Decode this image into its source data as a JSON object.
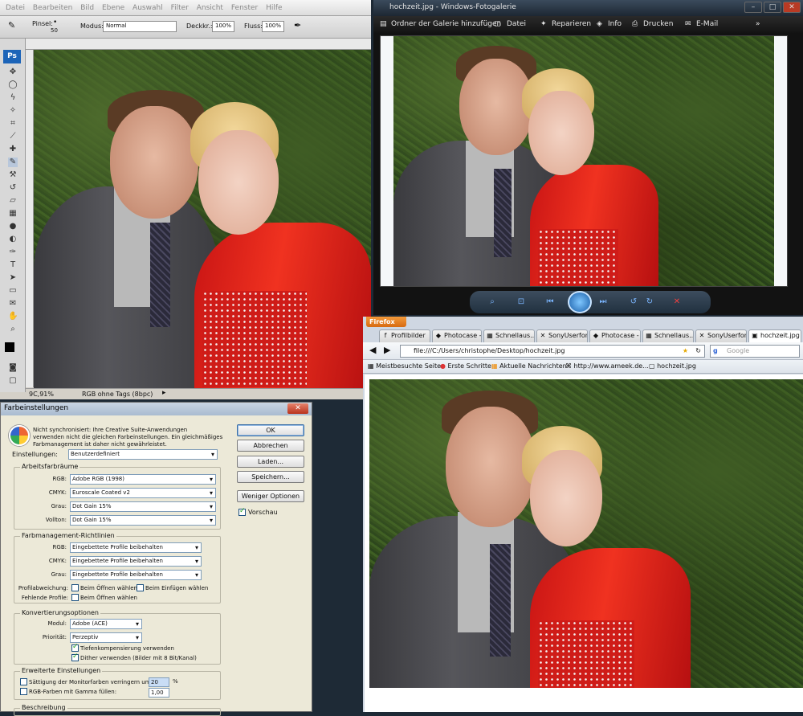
{
  "photoshop": {
    "menu": [
      "Datei",
      "Bearbeiten",
      "Bild",
      "Ebene",
      "Auswahl",
      "Filter",
      "Ansicht",
      "Fenster",
      "Hilfe"
    ],
    "options": {
      "brush_label": "Pinsel:",
      "brush_size": "50",
      "mode_label": "Modus:",
      "mode_value": "Normal",
      "opacity_label": "Deckkr.:",
      "opacity_value": "100%",
      "flow_label": "Fluss:",
      "flow_value": "100%"
    },
    "logo": "Ps",
    "status": {
      "zoom": "9C,91%",
      "profile": "RGB ohne Tags (8bpc)"
    }
  },
  "gallery": {
    "title": "hochzeit.jpg - Windows-Fotogalerie",
    "toolbar": [
      "Ordner der Galerie hinzufügen",
      "Datei",
      "Reparieren",
      "Info",
      "Drucken",
      "E-Mail"
    ],
    "overflow": "»",
    "controls": {
      "min": "–",
      "max": "□",
      "close": "✕"
    }
  },
  "firefox": {
    "app_button": "Firefox",
    "tabs": [
      {
        "icon": "f",
        "label": "Profilbilder"
      },
      {
        "icon": "◆",
        "label": "Photocase - ..."
      },
      {
        "icon": "▦",
        "label": "Schnellaus..."
      },
      {
        "icon": "✕",
        "label": "SonyUserfor..."
      },
      {
        "icon": "◆",
        "label": "Photocase - ..."
      },
      {
        "icon": "▦",
        "label": "Schnellaus..."
      },
      {
        "icon": "✕",
        "label": "SonyUserfor..."
      },
      {
        "icon": "▣",
        "label": "hochzeit.jpg"
      }
    ],
    "url": "file:///C:/Users/christophe/Desktop/hochzeit.jpg",
    "search_placeholder": "Google",
    "bookmarks": [
      "Meistbesuchte Seiten",
      "Erste Schritte",
      "Aktuelle Nachrichten",
      "http://www.ameek.de...",
      "hochzeit.jpg"
    ]
  },
  "dialog": {
    "title": "Farbeinstellungen",
    "close": "✕",
    "warning_lines": [
      "Nicht synchronisiert: Ihre Creative Suite-Anwendungen",
      "verwenden nicht die gleichen Farbeinstellungen. Ein gleichmäßiges",
      "Farbmanagement ist daher nicht gewährleistet."
    ],
    "buttons": [
      "OK",
      "Abbrechen",
      "Laden...",
      "Speichern...",
      "Weniger Optionen"
    ],
    "preview_label": "Vorschau",
    "settings_label": "Einstellungen:",
    "settings_value": "Benutzerdefiniert",
    "workspaces": {
      "title": "Arbeitsfarbräume",
      "rows": [
        {
          "label": "RGB:",
          "value": "Adobe RGB (1998)"
        },
        {
          "label": "CMYK:",
          "value": "Euroscale Coated v2"
        },
        {
          "label": "Grau:",
          "value": "Dot Gain 15%"
        },
        {
          "label": "Vollton:",
          "value": "Dot Gain 15%"
        }
      ]
    },
    "policies": {
      "title": "Farbmanagement-Richtlinien",
      "rows": [
        {
          "label": "RGB:",
          "value": "Eingebettete Profile beibehalten"
        },
        {
          "label": "CMYK:",
          "value": "Eingebettete Profile beibehalten"
        },
        {
          "label": "Grau:",
          "value": "Eingebettete Profile beibehalten"
        }
      ],
      "mismatch_label": "Profilabweichung:",
      "mismatch_open": "Beim Öffnen wählen",
      "mismatch_paste": "Beim Einfügen wählen",
      "missing_label": "Fehlende Profile:",
      "missing_open": "Beim Öffnen wählen"
    },
    "conversion": {
      "title": "Konvertierungsoptionen",
      "engine_label": "Modul:",
      "engine_value": "Adobe (ACE)",
      "intent_label": "Priorität:",
      "intent_value": "Perzeptiv",
      "bpc": "Tiefenkompensierung verwenden",
      "dither": "Dither verwenden (Bilder mit 8 Bit/Kanal)"
    },
    "advanced": {
      "title": "Erweiterte Einstellungen",
      "desaturate": "Sättigung der Monitorfarben verringern um:",
      "desaturate_value": "20",
      "percent": "%",
      "blend": "RGB-Farben mit Gamma füllen:",
      "blend_value": "1,00"
    },
    "description_title": "Beschreibung"
  }
}
